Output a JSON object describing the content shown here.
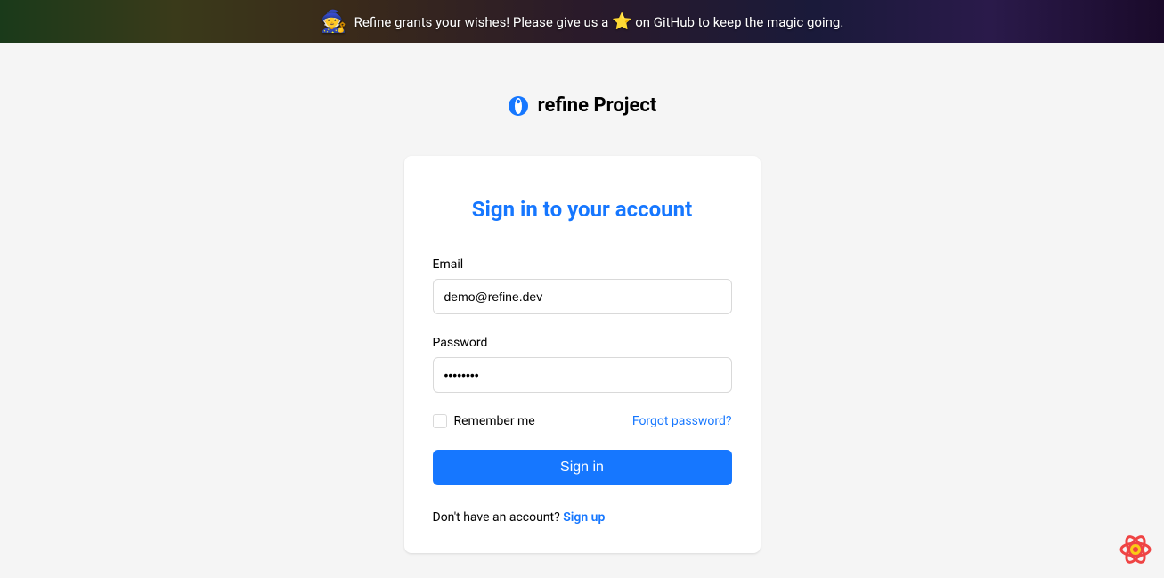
{
  "banner": {
    "text_before": "Refine grants your wishes! Please give us a ",
    "text_after": " on GitHub to keep the magic going.",
    "wizard_emoji": "🧙",
    "star_emoji": "⭐"
  },
  "brand": {
    "title": "refine Project"
  },
  "card": {
    "title": "Sign in to your account"
  },
  "form": {
    "email_label": "Email",
    "email_value": "demo@refine.dev",
    "password_label": "Password",
    "password_value": "demodemo",
    "remember_label": "Remember me",
    "forgot_label": "Forgot password?",
    "submit_label": "Sign in"
  },
  "signup": {
    "prompt": "Don't have an account? ",
    "link_label": "Sign up"
  },
  "colors": {
    "primary": "#1677ff"
  }
}
